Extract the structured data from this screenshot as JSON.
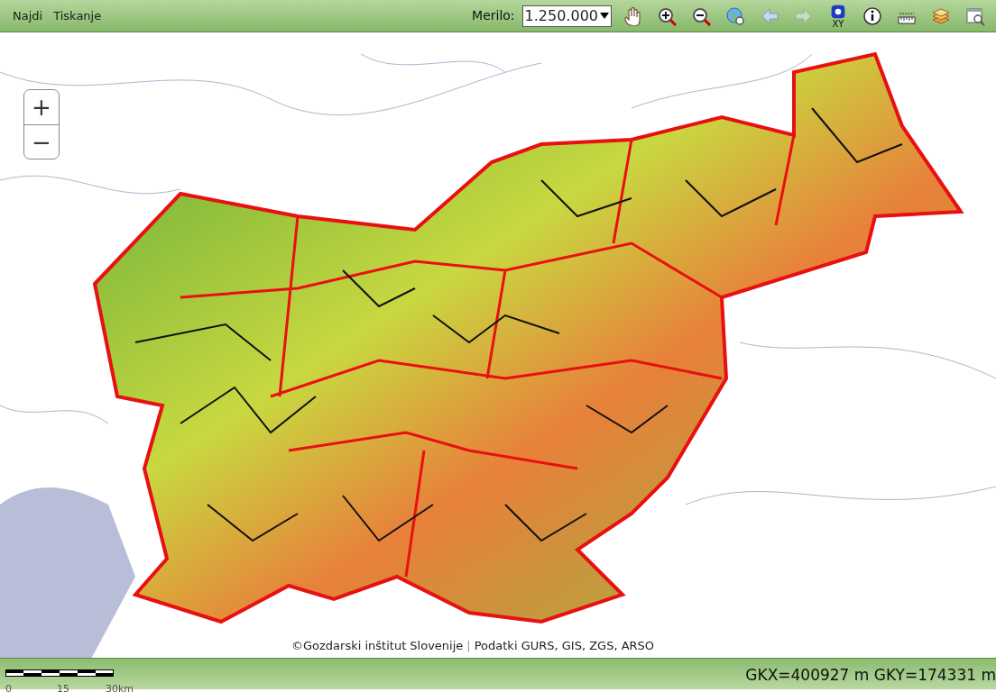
{
  "menu": [
    {
      "label": "Najdi"
    },
    {
      "label": "Tiskanje"
    }
  ],
  "scale": {
    "label": "Merilo:",
    "value": "1.250.000"
  },
  "coordinate_tool": {
    "caption": "XY"
  },
  "zoom_controls": [
    "+",
    "−"
  ],
  "attribution": {
    "owner": "©Gozdarski inštitut Slovenije",
    "separator": "|",
    "sources": "Podatki GURS, GIS, ZGS, ARSO"
  },
  "scale_bar": {
    "labels": [
      "0",
      "15",
      "30km"
    ]
  },
  "status_bar": {
    "coordinates": "GKX=400927 m GKY=174331 m"
  }
}
